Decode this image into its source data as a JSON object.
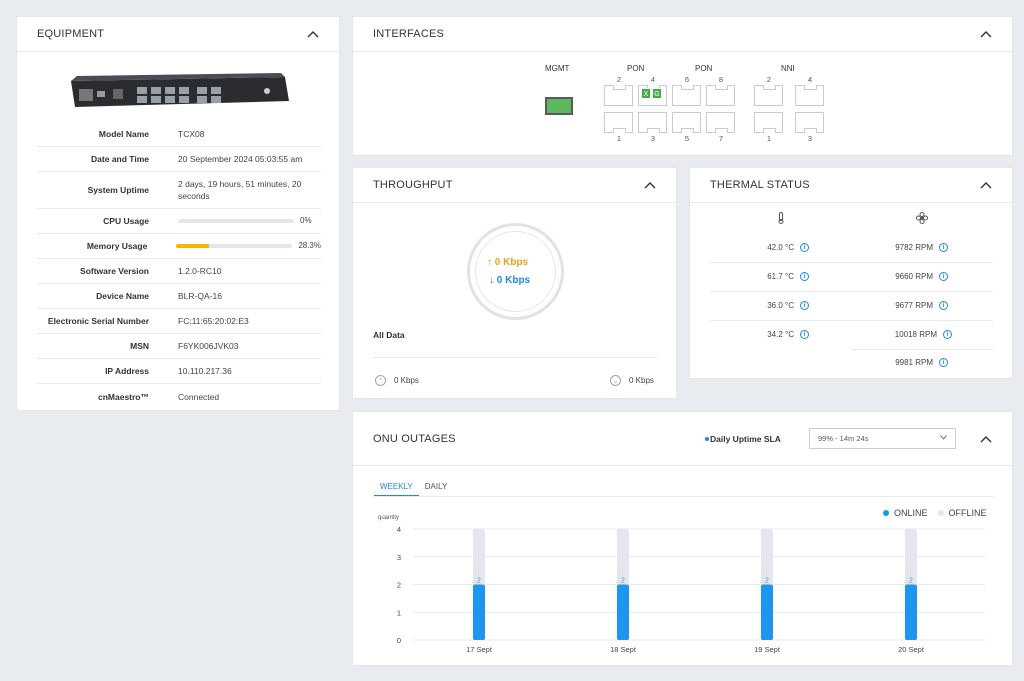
{
  "equipment": {
    "title": "EQUIPMENT",
    "rows": [
      {
        "label": "Model Name",
        "value": "TCX08"
      },
      {
        "label": "Date and Time",
        "value": "20 September 2024 05:03:55 am"
      },
      {
        "label": "System Uptime",
        "value": "2 days, 19 hours, 51 minutes, 20 seconds"
      },
      {
        "label": "CPU Usage",
        "value": "0%",
        "percent": 0
      },
      {
        "label": "Memory Usage",
        "value": "28.3%",
        "percent": 28.3
      },
      {
        "label": "Software Version",
        "value": "1.2.0-RC10"
      },
      {
        "label": "Device Name",
        "value": "BLR-QA-16"
      },
      {
        "label": "Electronic Serial Number",
        "value": "FC:11:65:20:02:E3"
      },
      {
        "label": "MSN",
        "value": "F6YK006JVK03"
      },
      {
        "label": "IP Address",
        "value": "10.110.217.36"
      },
      {
        "label": "cnMaestro™",
        "value": "Connected"
      }
    ],
    "bar_color": "#f5b800"
  },
  "interfaces": {
    "title": "INTERFACES",
    "mgmt_label": "MGMT",
    "pon1_label": "PON",
    "pon2_label": "PON",
    "nni_label": "NNI",
    "pon1_top": [
      "2",
      "4"
    ],
    "pon1_bottom": [
      "1",
      "3"
    ],
    "pon2_top": [
      "6",
      "8"
    ],
    "pon2_bottom": [
      "5",
      "7"
    ],
    "nni_top": [
      "2",
      "4"
    ],
    "nni_bottom": [
      "1",
      "3"
    ],
    "port4_badges": [
      "X",
      "G"
    ],
    "mgmt_color": "#5cb85c"
  },
  "throughput": {
    "title": "THROUGHPUT",
    "up": "0 Kbps",
    "down": "0 Kbps",
    "section": "All Data",
    "foot_up": "0 Kbps",
    "foot_down": "0 Kbps"
  },
  "thermal": {
    "title": "THERMAL STATUS",
    "temps": [
      "42.0 °C",
      "61.7 °C",
      "36.0 °C",
      "34.2 °C"
    ],
    "fans": [
      "9782 RPM",
      "9660 RPM",
      "9677 RPM",
      "10018 RPM",
      "9981 RPM"
    ]
  },
  "onu": {
    "title": "ONU OUTAGES",
    "sla_label": "Daily Uptime SLA",
    "sla_value": "99% - 14m 24s",
    "tabs": [
      "WEEKLY",
      "DAILY"
    ],
    "legend": [
      {
        "name": "ONLINE",
        "color": "#1e95ef"
      },
      {
        "name": "OFFLINE",
        "color": "#e3e6ec"
      }
    ]
  },
  "chart_data": {
    "type": "bar",
    "ylabel": "quantity",
    "ylim": [
      0,
      4
    ],
    "yticks": [
      0,
      1,
      2,
      3,
      4
    ],
    "categories": [
      "17 Sept",
      "18 Sept",
      "19 Sept",
      "20 Sept"
    ],
    "series": [
      {
        "name": "ONLINE",
        "values": [
          2,
          2,
          2,
          2
        ],
        "color": "#1e95ef"
      },
      {
        "name": "OFFLINE",
        "values": [
          2,
          2,
          2,
          2
        ],
        "color": "#e3e6ec"
      }
    ],
    "data_labels": [
      "2",
      "2",
      "2",
      "2"
    ],
    "legend_position": "top-right",
    "grid": true
  }
}
